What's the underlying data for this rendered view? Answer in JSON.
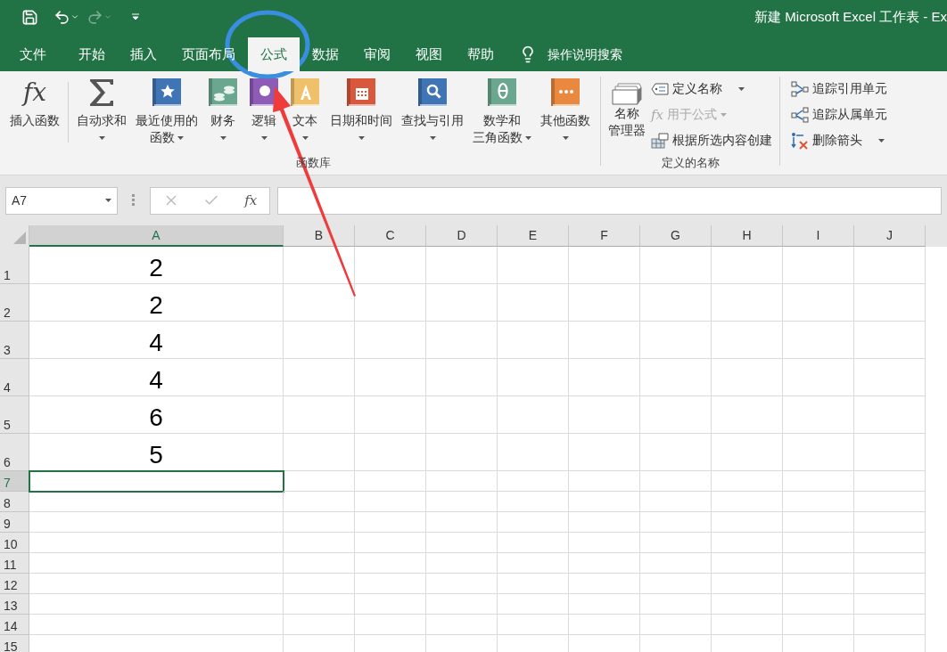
{
  "title": "新建 Microsoft Excel 工作表 - Ex",
  "tabs": [
    {
      "label": "文件",
      "selected": false
    },
    {
      "label": "开始",
      "selected": false
    },
    {
      "label": "插入",
      "selected": false
    },
    {
      "label": "页面布局",
      "selected": false
    },
    {
      "label": "公式",
      "selected": true
    },
    {
      "label": "数据",
      "selected": false
    },
    {
      "label": "审阅",
      "selected": false
    },
    {
      "label": "视图",
      "selected": false
    },
    {
      "label": "帮助",
      "selected": false
    }
  ],
  "search": {
    "label": "操作说明搜索"
  },
  "function_library": {
    "label": "函数库",
    "insert": {
      "lines": [
        "插入函数"
      ],
      "kind": "fx",
      "symbol": "fx",
      "dropdown": false
    },
    "buttons": [
      {
        "lines": [
          "自动求和"
        ],
        "kind": "sigma",
        "dropdown": true
      },
      {
        "lines": [
          "最近使用的",
          "函数"
        ],
        "kind": "star",
        "dropdown": true
      },
      {
        "lines": [
          "财务"
        ],
        "kind": "coins",
        "dropdown": true
      },
      {
        "lines": [
          "逻辑"
        ],
        "kind": "logic",
        "dropdown": true
      },
      {
        "lines": [
          "文本"
        ],
        "kind": "text",
        "dropdown": true
      },
      {
        "lines": [
          "日期和时间"
        ],
        "kind": "calendar",
        "dropdown": true
      },
      {
        "lines": [
          "查找与引用"
        ],
        "kind": "lookup",
        "dropdown": true
      },
      {
        "lines": [
          "数学和",
          "三角函数"
        ],
        "kind": "theta",
        "dropdown": true
      },
      {
        "lines": [
          "其他函数"
        ],
        "kind": "more",
        "dropdown": true
      }
    ]
  },
  "defined_names": {
    "label": "定义的名称",
    "manager": {
      "lines": [
        "名称",
        "管理器"
      ]
    },
    "items": [
      {
        "label": "定义名称",
        "kind": "tag",
        "dropdown": true,
        "disabled": false
      },
      {
        "label": "用于公式",
        "kind": "fx",
        "symbol": "fx",
        "dropdown": true,
        "disabled": true
      },
      {
        "label": "根据所选内容创建",
        "kind": "grid",
        "dropdown": false,
        "disabled": false
      }
    ]
  },
  "auditing": {
    "items": [
      {
        "label": "追踪引用单元",
        "kind": "precedents",
        "dropdown": false
      },
      {
        "label": "追踪从属单元",
        "kind": "dependents",
        "dropdown": false
      },
      {
        "label": "删除箭头",
        "kind": "remove",
        "dropdown": true
      }
    ]
  },
  "name_box": {
    "value": "A7"
  },
  "formula_bar": {
    "symbol": "fx"
  },
  "columns": [
    {
      "label": "A",
      "selected": true
    },
    {
      "label": "B",
      "selected": false
    },
    {
      "label": "C",
      "selected": false
    },
    {
      "label": "D",
      "selected": false
    },
    {
      "label": "E",
      "selected": false
    },
    {
      "label": "F",
      "selected": false
    },
    {
      "label": "G",
      "selected": false
    },
    {
      "label": "H",
      "selected": false
    },
    {
      "label": "I",
      "selected": false
    },
    {
      "label": "J",
      "selected": false
    }
  ],
  "rows": [
    {
      "label": "1",
      "value": "2",
      "selected": false
    },
    {
      "label": "2",
      "value": "2",
      "selected": false
    },
    {
      "label": "3",
      "value": "4",
      "selected": false
    },
    {
      "label": "4",
      "value": "4",
      "selected": false
    },
    {
      "label": "5",
      "value": "6",
      "selected": false
    },
    {
      "label": "6",
      "value": "5",
      "selected": false
    },
    {
      "label": "7",
      "selected": true
    },
    {
      "label": "8",
      "selected": false
    },
    {
      "label": "9",
      "selected": false
    },
    {
      "label": "10",
      "selected": false
    },
    {
      "label": "11",
      "selected": false
    },
    {
      "label": "12",
      "selected": false
    },
    {
      "label": "13",
      "selected": false
    },
    {
      "label": "14",
      "selected": false
    },
    {
      "label": "15",
      "selected": false
    }
  ]
}
